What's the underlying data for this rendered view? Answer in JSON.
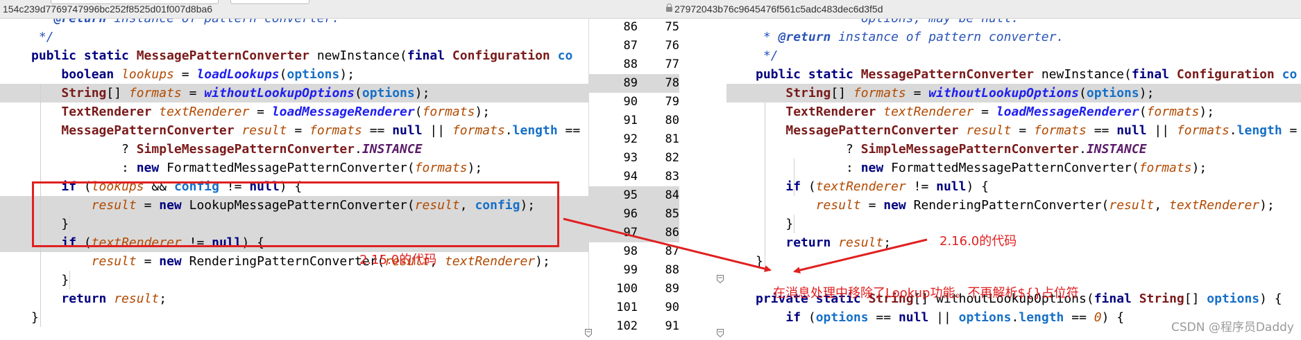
{
  "header": {
    "left_hash": "154c239d7769747996bc252f8525d01f007d8ba6",
    "right_hash": "27972043b76c9645476f561c5adc483dec6d3f5d"
  },
  "left_code": [
    [
      [
        "doc",
        " * "
      ],
      [
        "doctag",
        "@return"
      ],
      [
        "doc",
        " instance of pattern converter."
      ]
    ],
    [
      [
        "doc",
        " */"
      ]
    ],
    [
      [
        "kw",
        "public static "
      ],
      [
        "cls",
        "MessagePatternConverter "
      ],
      [
        "t",
        "newInstance("
      ],
      [
        "kw",
        "final "
      ],
      [
        "cls",
        "Configuration "
      ],
      [
        "fld",
        "co"
      ]
    ],
    [
      [
        "t",
        "    "
      ],
      [
        "kw",
        "boolean "
      ],
      [
        "var",
        "lookups"
      ],
      [
        "t",
        " = "
      ],
      [
        "mth",
        "loadLookups"
      ],
      [
        "t",
        "("
      ],
      [
        "fld",
        "options"
      ],
      [
        "t",
        ");"
      ]
    ],
    [
      [
        "t",
        "    "
      ],
      [
        "cls",
        "String"
      ],
      [
        "t",
        "[] "
      ],
      [
        "var",
        "formats"
      ],
      [
        "t",
        " = "
      ],
      [
        "mth",
        "withoutLookupOptions"
      ],
      [
        "t",
        "("
      ],
      [
        "fld",
        "options"
      ],
      [
        "t",
        ");"
      ]
    ],
    [
      [
        "t",
        "    "
      ],
      [
        "cls",
        "TextRenderer "
      ],
      [
        "var",
        "textRenderer"
      ],
      [
        "t",
        " = "
      ],
      [
        "mth",
        "loadMessageRenderer"
      ],
      [
        "t",
        "("
      ],
      [
        "var",
        "formats"
      ],
      [
        "t",
        ");"
      ]
    ],
    [
      [
        "t",
        "    "
      ],
      [
        "cls",
        "MessagePatternConverter "
      ],
      [
        "var",
        "result"
      ],
      [
        "t",
        " = "
      ],
      [
        "var",
        "formats"
      ],
      [
        "t",
        " == "
      ],
      [
        "kw",
        "null"
      ],
      [
        "t",
        " || "
      ],
      [
        "var",
        "formats"
      ],
      [
        "t",
        "."
      ],
      [
        "fld",
        "length"
      ],
      [
        "t",
        " =="
      ]
    ],
    [
      [
        "t",
        "            ? "
      ],
      [
        "cls",
        "SimpleMessagePatternConverter"
      ],
      [
        "t",
        "."
      ],
      [
        "cst",
        "INSTANCE"
      ]
    ],
    [
      [
        "t",
        "            : "
      ],
      [
        "kw",
        "new "
      ],
      [
        "t",
        "FormattedMessagePatternConverter("
      ],
      [
        "var",
        "formats"
      ],
      [
        "t",
        ");"
      ]
    ],
    [
      [
        "t",
        "    "
      ],
      [
        "kw",
        "if "
      ],
      [
        "t",
        "("
      ],
      [
        "var",
        "lookups"
      ],
      [
        "t",
        " && "
      ],
      [
        "fld",
        "config"
      ],
      [
        "t",
        " != "
      ],
      [
        "kw",
        "null"
      ],
      [
        "t",
        ") {"
      ]
    ],
    [
      [
        "t",
        "        "
      ],
      [
        "var",
        "result"
      ],
      [
        "t",
        " = "
      ],
      [
        "kw",
        "new "
      ],
      [
        "t",
        "LookupMessagePatternConverter("
      ],
      [
        "var",
        "result"
      ],
      [
        "t",
        ", "
      ],
      [
        "fld",
        "config"
      ],
      [
        "t",
        ");"
      ]
    ],
    [
      [
        "t",
        "    }"
      ]
    ],
    [
      [
        "t",
        "    "
      ],
      [
        "kw",
        "if "
      ],
      [
        "t",
        "("
      ],
      [
        "var",
        "textRenderer"
      ],
      [
        "t",
        " != "
      ],
      [
        "kw",
        "null"
      ],
      [
        "t",
        ") {"
      ]
    ],
    [
      [
        "t",
        "        "
      ],
      [
        "var",
        "result"
      ],
      [
        "t",
        " = "
      ],
      [
        "kw",
        "new "
      ],
      [
        "t",
        "RenderingPatternConverter("
      ],
      [
        "var",
        "result"
      ],
      [
        "t",
        ", "
      ],
      [
        "var",
        "textRenderer"
      ],
      [
        "t",
        ");"
      ]
    ],
    [
      [
        "t",
        "    }"
      ]
    ],
    [
      [
        "t",
        "    "
      ],
      [
        "kw",
        "return "
      ],
      [
        "var",
        "result"
      ],
      [
        "t",
        ";"
      ]
    ],
    [
      [
        "t",
        "}"
      ]
    ]
  ],
  "right_code": [
    [
      [
        "doc",
        " *            options, may be null."
      ]
    ],
    [
      [
        "doc",
        " * "
      ],
      [
        "doctag",
        "@return"
      ],
      [
        "doc",
        " instance of pattern converter."
      ]
    ],
    [
      [
        "doc",
        " */"
      ]
    ],
    [
      [
        "kw",
        "public static "
      ],
      [
        "cls",
        "MessagePatternConverter "
      ],
      [
        "t",
        "newInstance("
      ],
      [
        "kw",
        "final "
      ],
      [
        "cls",
        "Configuration "
      ],
      [
        "fld",
        "co"
      ]
    ],
    [
      [
        "t",
        "    "
      ],
      [
        "cls",
        "String"
      ],
      [
        "t",
        "[] "
      ],
      [
        "var",
        "formats"
      ],
      [
        "t",
        " = "
      ],
      [
        "mth",
        "withoutLookupOptions"
      ],
      [
        "t",
        "("
      ],
      [
        "fld",
        "options"
      ],
      [
        "t",
        ");"
      ]
    ],
    [
      [
        "t",
        "    "
      ],
      [
        "cls",
        "TextRenderer "
      ],
      [
        "var",
        "textRenderer"
      ],
      [
        "t",
        " = "
      ],
      [
        "mth",
        "loadMessageRenderer"
      ],
      [
        "t",
        "("
      ],
      [
        "var",
        "formats"
      ],
      [
        "t",
        ");"
      ]
    ],
    [
      [
        "t",
        "    "
      ],
      [
        "cls",
        "MessagePatternConverter "
      ],
      [
        "var",
        "result"
      ],
      [
        "t",
        " = "
      ],
      [
        "var",
        "formats"
      ],
      [
        "t",
        " == "
      ],
      [
        "kw",
        "null"
      ],
      [
        "t",
        " || "
      ],
      [
        "var",
        "formats"
      ],
      [
        "t",
        "."
      ],
      [
        "fld",
        "length"
      ],
      [
        "t",
        " ="
      ]
    ],
    [
      [
        "t",
        "            ? "
      ],
      [
        "cls",
        "SimpleMessagePatternConverter"
      ],
      [
        "t",
        "."
      ],
      [
        "cst",
        "INSTANCE"
      ]
    ],
    [
      [
        "t",
        "            : "
      ],
      [
        "kw",
        "new "
      ],
      [
        "t",
        "FormattedMessagePatternConverter("
      ],
      [
        "var",
        "formats"
      ],
      [
        "t",
        ");"
      ]
    ],
    [
      [
        "t",
        "    "
      ],
      [
        "kw",
        "if "
      ],
      [
        "t",
        "("
      ],
      [
        "var",
        "textRenderer"
      ],
      [
        "t",
        " != "
      ],
      [
        "kw",
        "null"
      ],
      [
        "t",
        ") {"
      ]
    ],
    [
      [
        "t",
        "        "
      ],
      [
        "var",
        "result"
      ],
      [
        "t",
        " = "
      ],
      [
        "kw",
        "new "
      ],
      [
        "t",
        "RenderingPatternConverter("
      ],
      [
        "var",
        "result"
      ],
      [
        "t",
        ", "
      ],
      [
        "var",
        "textRenderer"
      ],
      [
        "t",
        ");"
      ]
    ],
    [
      [
        "t",
        "    }"
      ]
    ],
    [
      [
        "t",
        "    "
      ],
      [
        "kw",
        "return "
      ],
      [
        "var",
        "result"
      ],
      [
        "t",
        ";"
      ]
    ],
    [
      [
        "t",
        "}"
      ]
    ],
    [
      [
        "t",
        ""
      ]
    ],
    [
      [
        "kw",
        "private static "
      ],
      [
        "cls",
        "String"
      ],
      [
        "t",
        "[] withoutLookupOptions("
      ],
      [
        "kw",
        "final "
      ],
      [
        "cls",
        "String"
      ],
      [
        "t",
        "[] "
      ],
      [
        "fld",
        "options"
      ],
      [
        "t",
        ") {"
      ]
    ],
    [
      [
        "t",
        "    "
      ],
      [
        "kw",
        "if "
      ],
      [
        "t",
        "("
      ],
      [
        "fld",
        "options"
      ],
      [
        "t",
        " == "
      ],
      [
        "kw",
        "null"
      ],
      [
        "t",
        " || "
      ],
      [
        "fld",
        "options"
      ],
      [
        "t",
        "."
      ],
      [
        "fld",
        "length"
      ],
      [
        "t",
        " == "
      ],
      [
        "var",
        "0"
      ],
      [
        "t",
        ") {"
      ]
    ]
  ],
  "line_numbers": {
    "left": [
      "86",
      "87",
      "88",
      "89",
      "90",
      "91",
      "92",
      "93",
      "94",
      "95",
      "96",
      "97",
      "98",
      "99",
      "100",
      "101",
      "102"
    ],
    "right": [
      "75",
      "76",
      "77",
      "78",
      "79",
      "80",
      "81",
      "82",
      "83",
      "84",
      "85",
      "86",
      "87",
      "88",
      "89",
      "90",
      "91"
    ]
  },
  "annotations": {
    "left_note": "2.15.0的代码",
    "right_note": "2.16.0的代码",
    "bottom_note": "在消息处理中移除了Lookup功能。不再解析${}占位符"
  },
  "watermark": "CSDN @程序员Daddy",
  "colors": {
    "annotation": "#e02020",
    "changed_line": "#d9d9d9"
  }
}
